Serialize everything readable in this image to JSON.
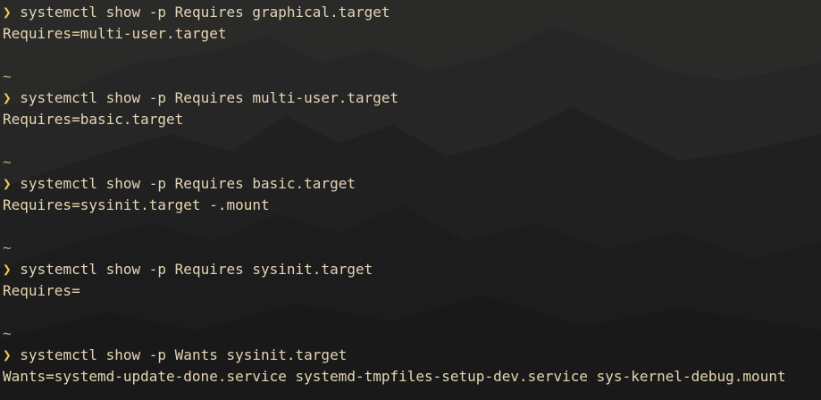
{
  "theme": {
    "background": "#232323",
    "text": "#e2d5b4",
    "prompt_symbol_color": "#f0c75e",
    "tilde_color": "#8ec07c"
  },
  "prompt": {
    "symbol": "❯",
    "cwd": "~"
  },
  "blocks": [
    {
      "command": "systemctl show -p Requires graphical.target",
      "output": "Requires=multi-user.target"
    },
    {
      "command": "systemctl show -p Requires multi-user.target",
      "output": "Requires=basic.target"
    },
    {
      "command": "systemctl show -p Requires basic.target",
      "output": "Requires=sysinit.target -.mount"
    },
    {
      "command": "systemctl show -p Requires sysinit.target",
      "output": "Requires="
    },
    {
      "command": "systemctl show -p Wants sysinit.target",
      "output": "Wants=systemd-update-done.service systemd-tmpfiles-setup-dev.service sys-kernel-debug.mount"
    }
  ]
}
